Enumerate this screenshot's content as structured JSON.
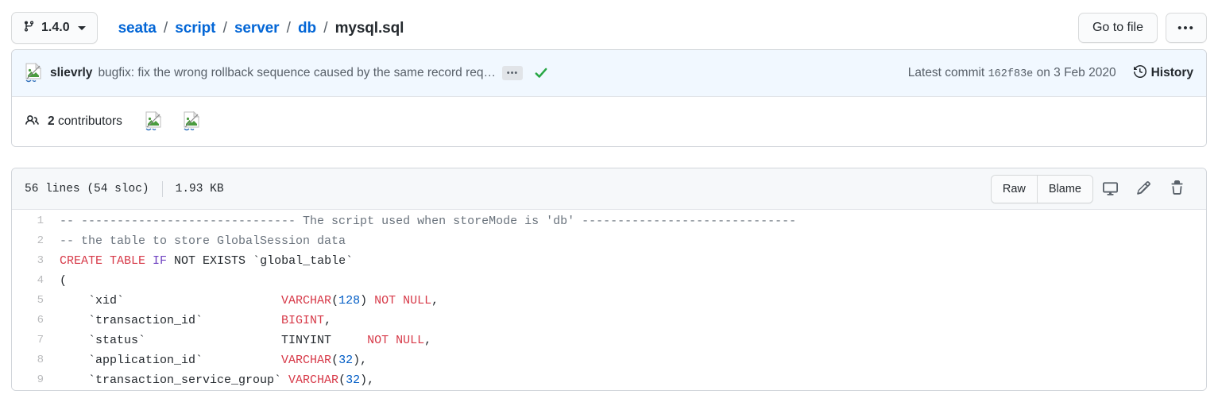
{
  "header": {
    "branch_icon": "branch-icon",
    "branch_label": "1.4.0",
    "breadcrumb": [
      {
        "label": "seata",
        "link": true
      },
      {
        "label": "script",
        "link": true
      },
      {
        "label": "server",
        "link": true
      },
      {
        "label": "db",
        "link": true
      },
      {
        "label": "mysql.sql",
        "link": false
      }
    ],
    "separator": "/",
    "go_to_file_label": "Go to file",
    "kebab_label": "•••"
  },
  "commit": {
    "avatar_icon": "broken-image-icon",
    "author": "slievrly",
    "message": "bugfix: fix the wrong rollback sequence caused by the same record req…",
    "expand_label": "•••",
    "status_icon": "check-icon",
    "latest_commit_prefix": "Latest commit",
    "sha": "162f83e",
    "date_prefix": "on",
    "date": "3 Feb 2020",
    "history_icon": "history-clock-icon",
    "history_label": "History"
  },
  "contributors": {
    "icon": "people-icon",
    "count": "2",
    "label": "contributors",
    "avatars": [
      "broken-image-icon",
      "broken-image-icon"
    ]
  },
  "file_meta": {
    "lines": "56 lines (54 sloc)",
    "size": "1.93 KB",
    "raw_label": "Raw",
    "blame_label": "Blame",
    "desktop_icon": "open-in-desktop-icon",
    "edit_icon": "pencil-icon",
    "delete_icon": "trash-icon"
  },
  "colors": {
    "link": "#0366d6",
    "commit_bg": "#f1f8ff",
    "header_bg": "#f6f8fa",
    "border": "#d1d5da",
    "keyword": "#d73a49",
    "keyword_alt": "#6f42c1",
    "number": "#005cc5",
    "comment": "#6a737d",
    "check_green": "#28a745"
  },
  "code": {
    "language": "sql",
    "lines": [
      {
        "n": "1",
        "tokens": [
          {
            "t": "-- ------------------------------ The script used when storeMode is 'db' ------------------------------",
            "c": "tok-c"
          }
        ]
      },
      {
        "n": "2",
        "tokens": [
          {
            "t": "-- the table to store GlobalSession data",
            "c": "tok-c"
          }
        ]
      },
      {
        "n": "3",
        "tokens": [
          {
            "t": "CREATE TABLE ",
            "c": "tok-k"
          },
          {
            "t": "IF",
            "c": "tok-kp"
          },
          {
            "t": " NOT EXISTS `global_table`",
            "c": ""
          }
        ]
      },
      {
        "n": "4",
        "tokens": [
          {
            "t": "(",
            "c": ""
          }
        ]
      },
      {
        "n": "5",
        "tokens": [
          {
            "t": "    `xid`                      ",
            "c": ""
          },
          {
            "t": "VARCHAR",
            "c": "tok-k"
          },
          {
            "t": "(",
            "c": ""
          },
          {
            "t": "128",
            "c": "tok-n"
          },
          {
            "t": ") ",
            "c": ""
          },
          {
            "t": "NOT NULL",
            "c": "tok-k"
          },
          {
            "t": ",",
            "c": ""
          }
        ]
      },
      {
        "n": "6",
        "tokens": [
          {
            "t": "    `transaction_id`           ",
            "c": ""
          },
          {
            "t": "BIGINT",
            "c": "tok-k"
          },
          {
            "t": ",",
            "c": ""
          }
        ]
      },
      {
        "n": "7",
        "tokens": [
          {
            "t": "    `status`                   TINYINT     ",
            "c": ""
          },
          {
            "t": "NOT NULL",
            "c": "tok-k"
          },
          {
            "t": ",",
            "c": ""
          }
        ]
      },
      {
        "n": "8",
        "tokens": [
          {
            "t": "    `application_id`           ",
            "c": ""
          },
          {
            "t": "VARCHAR",
            "c": "tok-k"
          },
          {
            "t": "(",
            "c": ""
          },
          {
            "t": "32",
            "c": "tok-n"
          },
          {
            "t": "),",
            "c": ""
          }
        ]
      },
      {
        "n": "9",
        "tokens": [
          {
            "t": "    `transaction_service_group` ",
            "c": ""
          },
          {
            "t": "VARCHAR",
            "c": "tok-k"
          },
          {
            "t": "(",
            "c": ""
          },
          {
            "t": "32",
            "c": "tok-n"
          },
          {
            "t": "),",
            "c": ""
          }
        ]
      }
    ]
  }
}
